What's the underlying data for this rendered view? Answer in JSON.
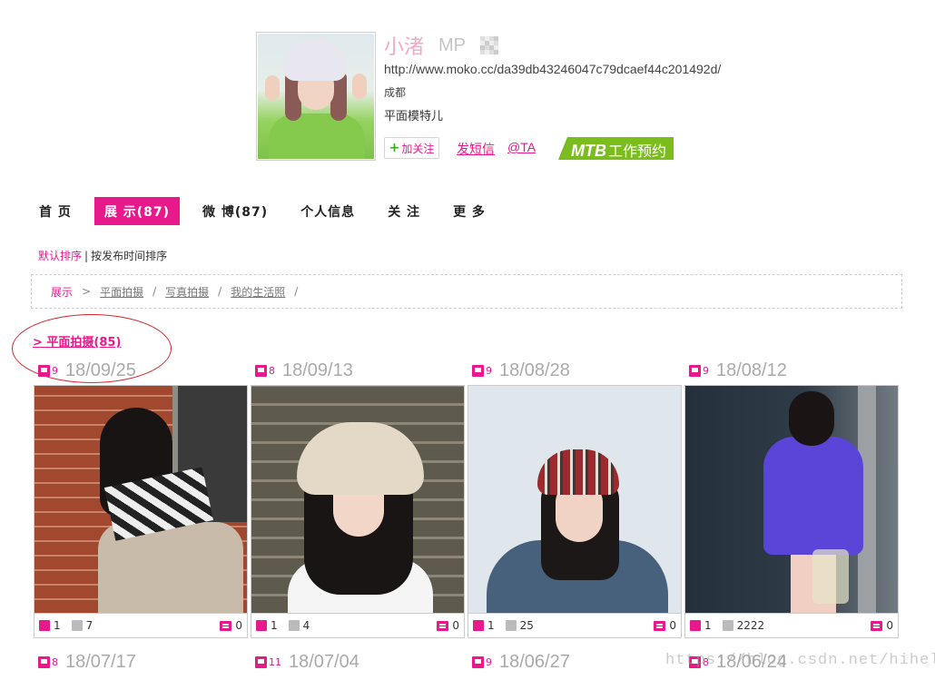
{
  "profile": {
    "name": "小渚",
    "badge": "MP",
    "url": "http://www.moko.cc/da39db43246047c79dcaef44c201492d/",
    "city": "成都",
    "profession": "平面模特儿",
    "follow_label": "加关注",
    "message_label": "发短信",
    "at_label": "@TA",
    "mtb_bold": "MTB",
    "mtb_text": "工作预约"
  },
  "nav": {
    "items": [
      {
        "label": "首 页"
      },
      {
        "label": "展 示(87)"
      },
      {
        "label": "微 博(87)"
      },
      {
        "label": "个人信息"
      },
      {
        "label": "关 注"
      },
      {
        "label": "更 多"
      }
    ],
    "active_index": 1
  },
  "sort": {
    "default_label": "默认排序",
    "separator": "|",
    "by_time_label": "按发布时间排序"
  },
  "breadcrumb": {
    "items": [
      "展示",
      "平面拍摄",
      "写真拍摄",
      "我的生活照"
    ],
    "first_sep": ">",
    "sep": "/"
  },
  "category": {
    "label": "> 平面拍摄(85)"
  },
  "albums": [
    {
      "count": "9",
      "date": "18/09/25",
      "likes": "1",
      "views": "7",
      "comments": "0"
    },
    {
      "count": "8",
      "date": "18/09/13",
      "likes": "1",
      "views": "4",
      "comments": "0"
    },
    {
      "count": "9",
      "date": "18/08/28",
      "likes": "1",
      "views": "25",
      "comments": "0"
    },
    {
      "count": "9",
      "date": "18/08/12",
      "likes": "1",
      "views": "2222",
      "comments": "0"
    }
  ],
  "albums_row2": [
    {
      "count": "8",
      "date": "18/07/17"
    },
    {
      "count": "11",
      "date": "18/07/04"
    },
    {
      "count": "9",
      "date": "18/06/27"
    },
    {
      "count": "8",
      "date": "18/06/24"
    }
  ],
  "watermark": "https://blog.csdn.net/hihell",
  "colors": {
    "accent": "#e8198b",
    "name_pink": "#f4a7c5",
    "mtb_green": "#7cbd1e",
    "annotation_red": "#d9272e"
  }
}
